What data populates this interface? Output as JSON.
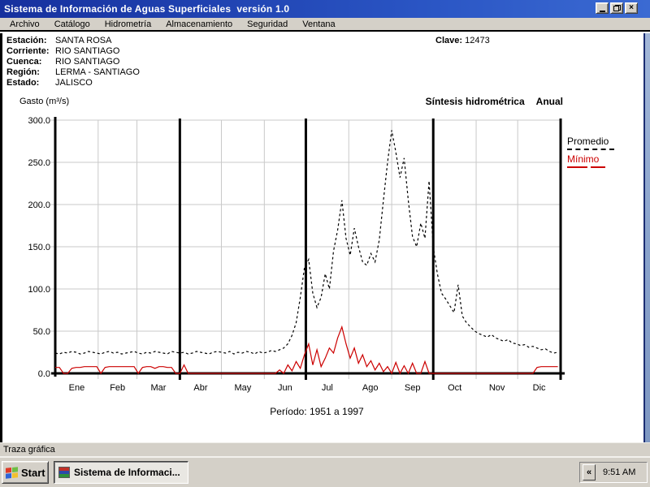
{
  "window": {
    "title": "Sistema de Información de Aguas Superficiales  versión 1.0",
    "icons": {
      "close_glyph": "×"
    }
  },
  "menu": {
    "items": [
      "Archivo",
      "Catálogo",
      "Hidrometría",
      "Almacenamiento",
      "Seguridad",
      "Ventana"
    ]
  },
  "station": {
    "fields": [
      {
        "label": "Estación:",
        "value": "SANTA ROSA"
      },
      {
        "label": "Corriente:",
        "value": "RIO SANTIAGO"
      },
      {
        "label": "Cuenca:",
        "value": "RIO SANTIAGO"
      },
      {
        "label": "Región:",
        "value": "LERMA - SANTIAGO"
      },
      {
        "label": "Estado:",
        "value": "JALISCO"
      }
    ],
    "clave_label": "Clave:",
    "clave_value": "12473"
  },
  "chart_data": {
    "type": "line",
    "title_left": "Síntesis hidrométrica",
    "title_right": "Anual",
    "ylabel": "Gasto (m³/s)",
    "period_label": "Período: 1951 a 1997",
    "ylim": [
      0,
      300
    ],
    "yticks": [
      0,
      50,
      100,
      150,
      200,
      250,
      300
    ],
    "ytick_labels": [
      "0.0",
      "50.0",
      "100.0",
      "150.0",
      "200.0",
      "250.0",
      "300.0"
    ],
    "categories": [
      "Ene",
      "Feb",
      "Mar",
      "Abr",
      "May",
      "Jun",
      "Jul",
      "Ago",
      "Sep",
      "Oct",
      "Nov",
      "Dic"
    ],
    "month_days": [
      31,
      28,
      31,
      30,
      31,
      30,
      31,
      31,
      30,
      31,
      30,
      31
    ],
    "quarter_line_days": [
      90,
      181,
      273
    ],
    "total_days": 365,
    "sample_interval_days": 3,
    "grid": true,
    "legend_position": "right",
    "colors": {
      "promedio": "#000000",
      "minimo": "#cc0000",
      "gridline": "#c9c9c9",
      "axis": "#000000"
    },
    "series": [
      {
        "name": "Promedio",
        "color": "#000000",
        "style": "dashed",
        "values": [
          24,
          23,
          25,
          24,
          26,
          25,
          23,
          24,
          26,
          25,
          24,
          23,
          25,
          26,
          24,
          25,
          23,
          24,
          25,
          26,
          24,
          23,
          25,
          24,
          26,
          25,
          24,
          23,
          26,
          25,
          24,
          25,
          23,
          24,
          26,
          25,
          24,
          23,
          25,
          26,
          25,
          24,
          26,
          23,
          25,
          24,
          26,
          25,
          23,
          26,
          24,
          25,
          27,
          26,
          28,
          30,
          35,
          45,
          60,
          90,
          125,
          135,
          95,
          78,
          90,
          118,
          100,
          145,
          170,
          205,
          160,
          140,
          172,
          150,
          132,
          128,
          142,
          132,
          158,
          205,
          250,
          288,
          262,
          232,
          255,
          205,
          162,
          150,
          178,
          160,
          228,
          150,
          118,
          95,
          88,
          80,
          72,
          105,
          68,
          60,
          55,
          50,
          47,
          45,
          43,
          46,
          42,
          40,
          38,
          40,
          36,
          35,
          33,
          34,
          31,
          32,
          30,
          28,
          29,
          26,
          24,
          25
        ]
      },
      {
        "name": "Mínimo",
        "color": "#cc0000",
        "style": "solid",
        "values": [
          7,
          7,
          0,
          0,
          6,
          7,
          7,
          8,
          8,
          8,
          8,
          0,
          7,
          8,
          8,
          8,
          8,
          8,
          8,
          8,
          0,
          7,
          8,
          8,
          6,
          8,
          8,
          7,
          7,
          0,
          0,
          10,
          0,
          0,
          0,
          0,
          0,
          0,
          0,
          0,
          0,
          0,
          0,
          0,
          0,
          0,
          0,
          0,
          0,
          0,
          0,
          0,
          0,
          0,
          4,
          0,
          10,
          3,
          14,
          6,
          22,
          35,
          10,
          28,
          8,
          18,
          30,
          24,
          42,
          55,
          35,
          18,
          30,
          12,
          22,
          8,
          15,
          4,
          12,
          2,
          8,
          0,
          13,
          0,
          9,
          0,
          12,
          0,
          0,
          14,
          0,
          0,
          0,
          0,
          0,
          0,
          0,
          0,
          0,
          0,
          0,
          0,
          0,
          0,
          0,
          0,
          0,
          0,
          0,
          0,
          0,
          0,
          0,
          0,
          0,
          0,
          7,
          8,
          8,
          8,
          8,
          8
        ]
      }
    ]
  },
  "status_bar": {
    "text": "Traza gráfica"
  },
  "taskbar": {
    "start_label": "Start",
    "task_label": "Sistema de Informaci...",
    "overflow_chevron": "«",
    "clock": "9:51 AM"
  }
}
